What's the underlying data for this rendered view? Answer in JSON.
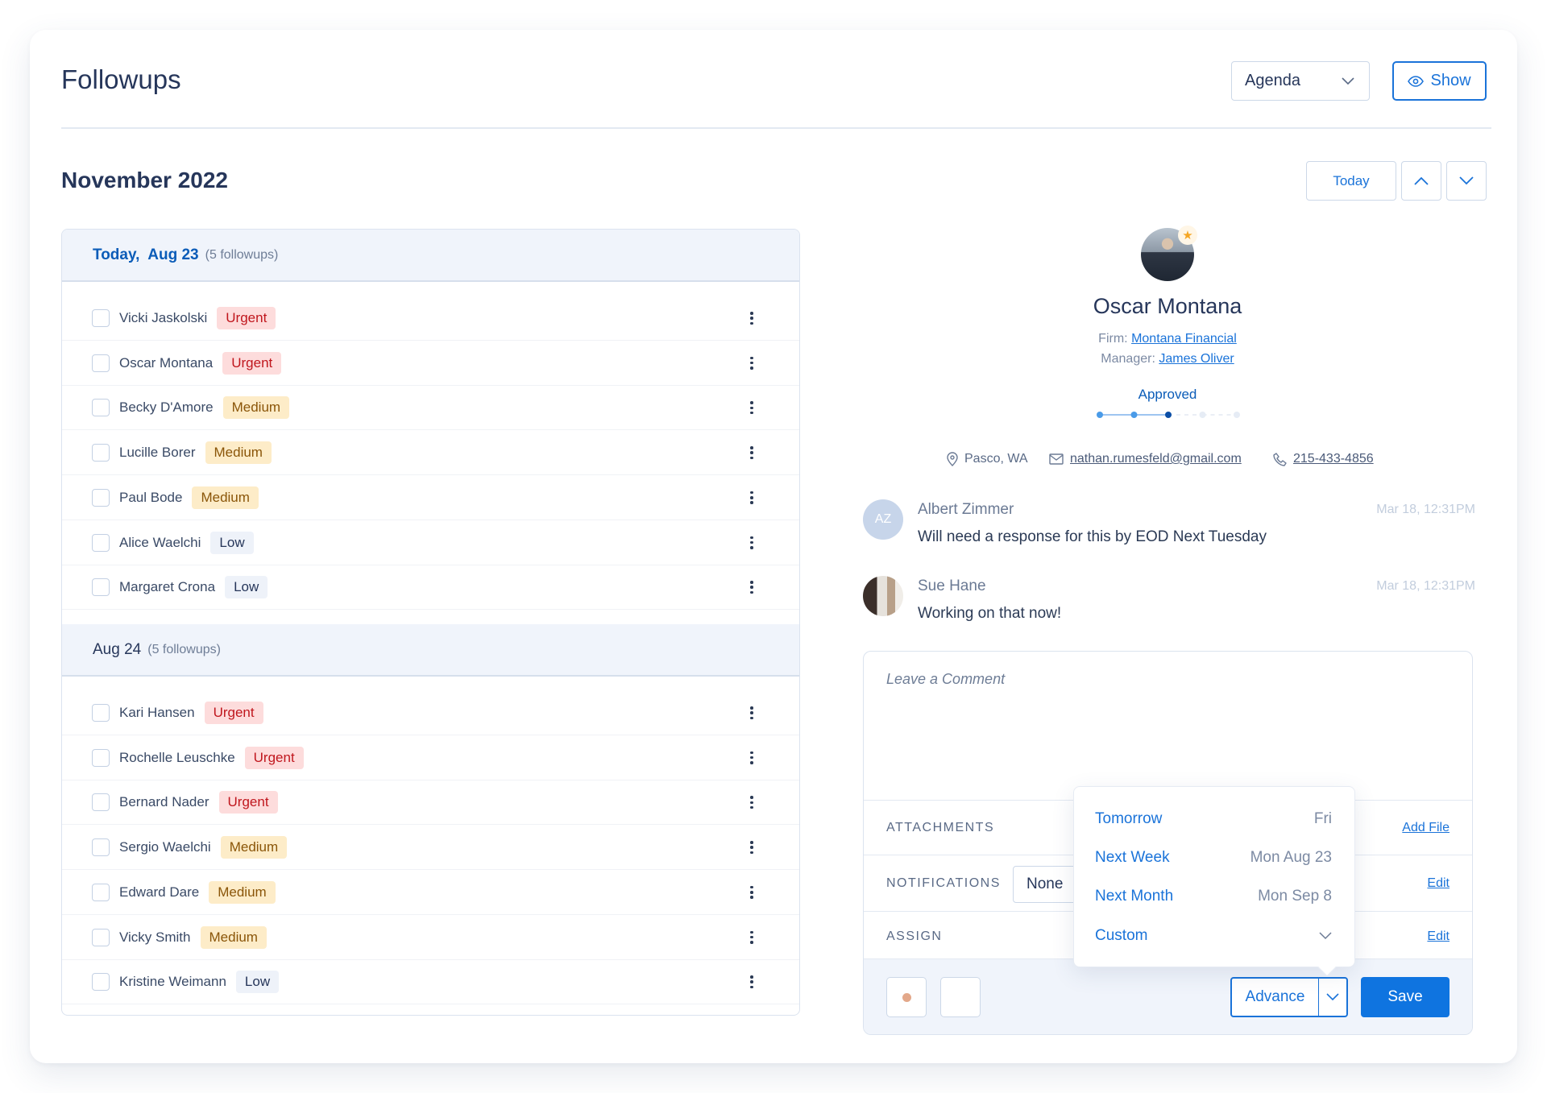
{
  "header": {
    "title": "Followups",
    "view_select": {
      "value": "Agenda"
    },
    "show_button": "Show"
  },
  "nav": {
    "month": "November 2022",
    "today_button": "Today"
  },
  "sections": [
    {
      "date_prefix": "Today,",
      "date": "Aug 23",
      "count": "(5 followups)",
      "rows": [
        {
          "name": "Vicki Jaskolski",
          "priority": "Urgent"
        },
        {
          "name": "Oscar Montana",
          "priority": "Urgent"
        },
        {
          "name": "Becky D'Amore",
          "priority": "Medium"
        },
        {
          "name": "Lucille Borer",
          "priority": "Medium"
        },
        {
          "name": "Paul Bode",
          "priority": "Medium"
        },
        {
          "name": "Alice Waelchi",
          "priority": "Low"
        },
        {
          "name": "Margaret Crona",
          "priority": "Low"
        }
      ]
    },
    {
      "date_prefix": "",
      "date": "Aug 24",
      "count": "(5 followups)",
      "rows": [
        {
          "name": "Kari Hansen",
          "priority": "Urgent"
        },
        {
          "name": "Rochelle Leuschke",
          "priority": "Urgent"
        },
        {
          "name": "Bernard Nader",
          "priority": "Urgent"
        },
        {
          "name": "Sergio Waelchi",
          "priority": "Medium"
        },
        {
          "name": "Edward Dare",
          "priority": "Medium"
        },
        {
          "name": "Vicky Smith",
          "priority": "Medium"
        },
        {
          "name": "Kristine Weimann",
          "priority": "Low"
        }
      ]
    }
  ],
  "profile": {
    "name": "Oscar Montana",
    "starred": true,
    "firm_label": "Firm:",
    "firm": "Montana Financial",
    "manager_label": "Manager:",
    "manager": "James Oliver",
    "status": "Approved",
    "progress": {
      "current_step": 3,
      "total_steps": 5
    },
    "location": "Pasco, WA",
    "email": "nathan.rumesfeld@gmail.com",
    "phone": "215-433-4856"
  },
  "comments": [
    {
      "initials": "AZ",
      "author": "Albert Zimmer",
      "time": "Mar 18, 12:31PM",
      "text": "Will need a response for this by EOD Next Tuesday"
    },
    {
      "initials": "",
      "author": "Sue Hane",
      "time": "Mar 18, 12:31PM",
      "text": "Working on that now!"
    }
  ],
  "composer": {
    "placeholder": "Leave a Comment",
    "attachments_label": "ATTACHMENTS",
    "add_file": "Add File",
    "notifications_label": "NOTIFICATIONS",
    "notifications_value": "None",
    "notifications_edit": "Edit",
    "assign_label": "ASSIGN",
    "assign_edit": "Edit",
    "advance_button": "Advance",
    "save_button": "Save"
  },
  "advance_menu": [
    {
      "label": "Tomorrow",
      "value": "Fri"
    },
    {
      "label": "Next Week",
      "value": "Mon Aug 23"
    },
    {
      "label": "Next Month",
      "value": "Mon Sep 8"
    },
    {
      "label": "Custom",
      "value": ""
    }
  ],
  "colors": {
    "accent": "#1a73d9",
    "urgent_bg": "#fddcdc",
    "urgent_fg": "#c0161d",
    "medium_bg": "#fdecc8",
    "medium_fg": "#8a5508",
    "low_bg": "#eef2f9",
    "low_fg": "#26365a"
  }
}
